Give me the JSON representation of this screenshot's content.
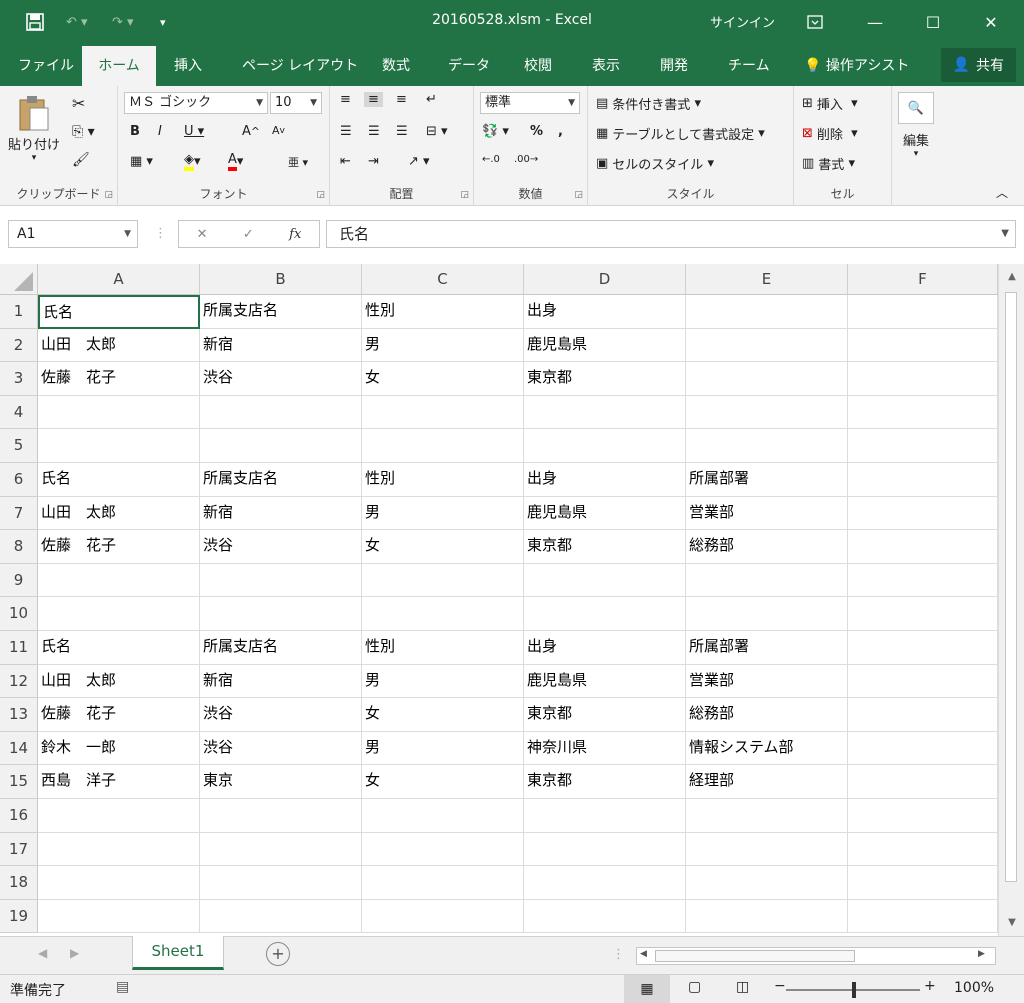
{
  "window": {
    "title": "20160528.xlsm - Excel",
    "signin": "サインイン"
  },
  "tabs": [
    {
      "label": "ファイル"
    },
    {
      "label": "ホーム"
    },
    {
      "label": "挿入"
    },
    {
      "label": "ページ レイアウト"
    },
    {
      "label": "数式"
    },
    {
      "label": "データ"
    },
    {
      "label": "校閲"
    },
    {
      "label": "表示"
    },
    {
      "label": "開発"
    },
    {
      "label": "チーム"
    },
    {
      "label": "操作アシスト"
    }
  ],
  "share_label": "共有",
  "ribbon": {
    "clipboard": {
      "paste": "貼り付け",
      "label": "クリップボード"
    },
    "font": {
      "name": "ＭＳ ゴシック",
      "size": "10",
      "label": "フォント"
    },
    "alignment": {
      "label": "配置"
    },
    "number": {
      "format": "標準",
      "label": "数値"
    },
    "styles": {
      "conditional": "条件付き書式",
      "table": "テーブルとして書式設定",
      "cell_style": "セルのスタイル",
      "label": "スタイル"
    },
    "cells": {
      "insert": "挿入",
      "delete": "削除",
      "format": "書式",
      "label": "セル"
    },
    "editing": {
      "label": "編集"
    }
  },
  "formula_bar": {
    "name_box": "A1",
    "content": "氏名"
  },
  "columns": [
    "A",
    "B",
    "C",
    "D",
    "E",
    "F"
  ],
  "rows": [
    [
      "氏名",
      "所属支店名",
      "性別",
      "出身",
      "",
      ""
    ],
    [
      "山田　太郎",
      "新宿",
      "男",
      "鹿児島県",
      "",
      ""
    ],
    [
      "佐藤　花子",
      "渋谷",
      "女",
      "東京都",
      "",
      ""
    ],
    [
      "",
      "",
      "",
      "",
      "",
      ""
    ],
    [
      "",
      "",
      "",
      "",
      "",
      ""
    ],
    [
      "氏名",
      "所属支店名",
      "性別",
      "出身",
      "所属部署",
      ""
    ],
    [
      "山田　太郎",
      "新宿",
      "男",
      "鹿児島県",
      "営業部",
      ""
    ],
    [
      "佐藤　花子",
      "渋谷",
      "女",
      "東京都",
      "総務部",
      ""
    ],
    [
      "",
      "",
      "",
      "",
      "",
      ""
    ],
    [
      "",
      "",
      "",
      "",
      "",
      ""
    ],
    [
      "氏名",
      "所属支店名",
      "性別",
      "出身",
      "所属部署",
      ""
    ],
    [
      "山田　太郎",
      "新宿",
      "男",
      "鹿児島県",
      "営業部",
      ""
    ],
    [
      "佐藤　花子",
      "渋谷",
      "女",
      "東京都",
      "総務部",
      ""
    ],
    [
      "鈴木　一郎",
      "渋谷",
      "男",
      "神奈川県",
      "情報システム部",
      ""
    ],
    [
      "西島　洋子",
      "東京",
      "女",
      "東京都",
      "経理部",
      ""
    ],
    [
      "",
      "",
      "",
      "",
      "",
      ""
    ],
    [
      "",
      "",
      "",
      "",
      "",
      ""
    ],
    [
      "",
      "",
      "",
      "",
      "",
      ""
    ],
    [
      "",
      "",
      "",
      "",
      "",
      ""
    ]
  ],
  "sheet_tab": "Sheet1",
  "status": {
    "ready": "準備完了",
    "zoom": "100%"
  },
  "colors": {
    "accent": "#217346"
  }
}
